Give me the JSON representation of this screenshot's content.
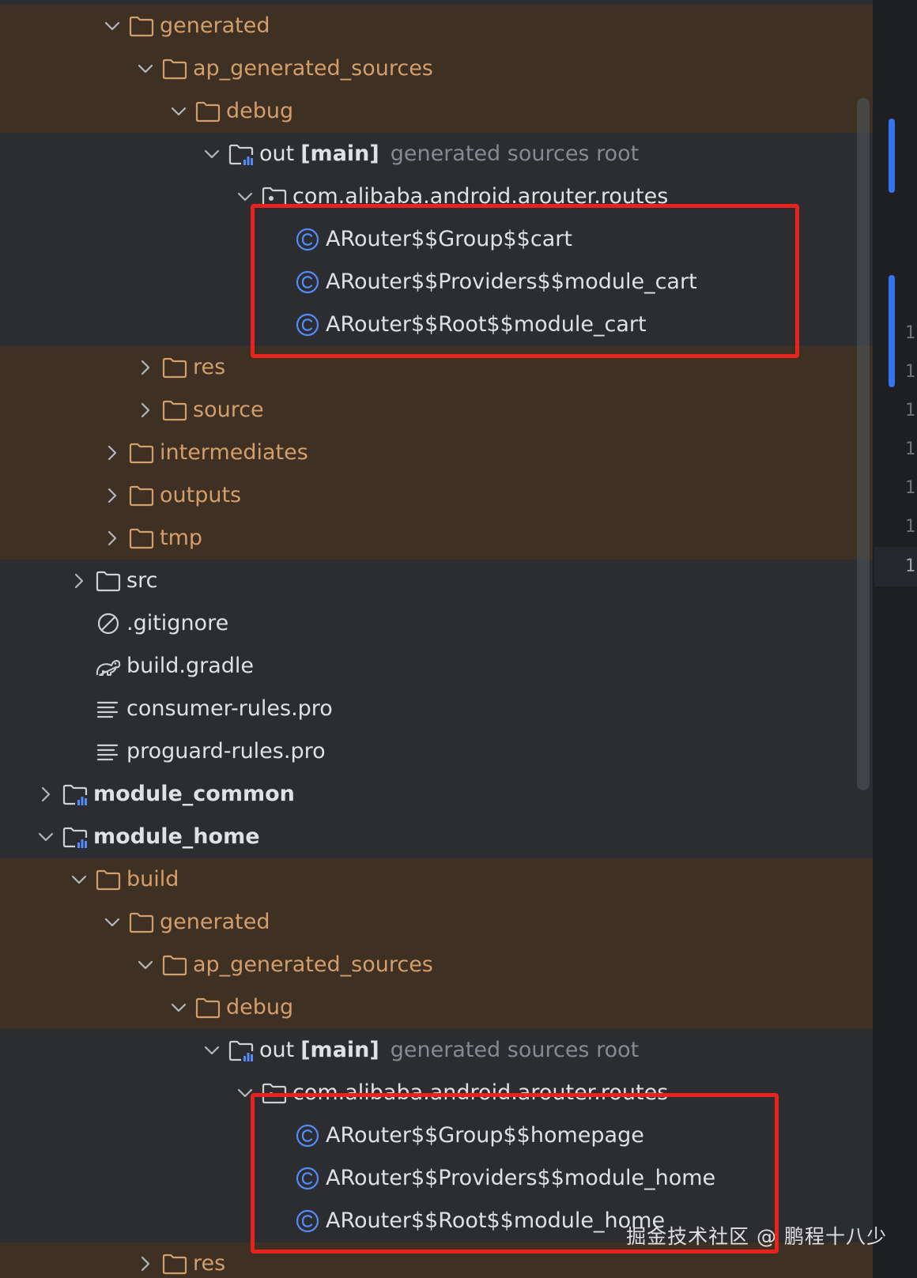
{
  "tree": [
    {
      "label": "generated",
      "icon": "folder-icon",
      "depth": 3,
      "chevron": "down",
      "tone": "excluded"
    },
    {
      "label": "ap_generated_sources",
      "icon": "folder-icon",
      "depth": 4,
      "chevron": "down",
      "tone": "excluded"
    },
    {
      "label": "debug",
      "icon": "folder-icon",
      "depth": 5,
      "chevron": "down",
      "tone": "excluded"
    },
    {
      "label": "out",
      "tag": "[main]",
      "hint": "generated sources root",
      "icon": "generated-root-icon",
      "depth": 6,
      "chevron": "down",
      "tone": "normal"
    },
    {
      "label": "com.alibaba.android.arouter.routes",
      "icon": "package-icon",
      "depth": 7,
      "chevron": "down",
      "tone": "normal"
    },
    {
      "label": "ARouter$$Group$$cart",
      "icon": "class-icon",
      "depth": 8,
      "chevron": "none",
      "tone": "normal"
    },
    {
      "label": "ARouter$$Providers$$module_cart",
      "icon": "class-icon",
      "depth": 8,
      "chevron": "none",
      "tone": "normal"
    },
    {
      "label": "ARouter$$Root$$module_cart",
      "icon": "class-icon",
      "depth": 8,
      "chevron": "none",
      "tone": "normal"
    },
    {
      "label": "res",
      "icon": "folder-icon",
      "depth": 4,
      "chevron": "right",
      "tone": "excluded"
    },
    {
      "label": "source",
      "icon": "folder-icon",
      "depth": 4,
      "chevron": "right",
      "tone": "excluded"
    },
    {
      "label": "intermediates",
      "icon": "folder-icon",
      "depth": 3,
      "chevron": "right",
      "tone": "excluded"
    },
    {
      "label": "outputs",
      "icon": "folder-icon",
      "depth": 3,
      "chevron": "right",
      "tone": "excluded"
    },
    {
      "label": "tmp",
      "icon": "folder-icon",
      "depth": 3,
      "chevron": "right",
      "tone": "excluded"
    },
    {
      "label": "src",
      "icon": "folder-icon",
      "depth": 2,
      "chevron": "right",
      "tone": "normal"
    },
    {
      "label": ".gitignore",
      "icon": "ignore-file-icon",
      "depth": 2,
      "chevron": "none",
      "tone": "normal"
    },
    {
      "label": "build.gradle",
      "icon": "gradle-icon",
      "depth": 2,
      "chevron": "none",
      "tone": "normal"
    },
    {
      "label": "consumer-rules.pro",
      "icon": "text-file-icon",
      "depth": 2,
      "chevron": "none",
      "tone": "normal"
    },
    {
      "label": "proguard-rules.pro",
      "icon": "text-file-icon",
      "depth": 2,
      "chevron": "none",
      "tone": "normal"
    },
    {
      "label": "module_common",
      "icon": "module-icon",
      "depth": 1,
      "chevron": "right",
      "tone": "normal",
      "bold": true
    },
    {
      "label": "module_home",
      "icon": "module-icon",
      "depth": 1,
      "chevron": "down",
      "tone": "normal",
      "bold": true
    },
    {
      "label": "build",
      "icon": "folder-icon",
      "depth": 2,
      "chevron": "down",
      "tone": "excluded"
    },
    {
      "label": "generated",
      "icon": "folder-icon",
      "depth": 3,
      "chevron": "down",
      "tone": "excluded"
    },
    {
      "label": "ap_generated_sources",
      "icon": "folder-icon",
      "depth": 4,
      "chevron": "down",
      "tone": "excluded"
    },
    {
      "label": "debug",
      "icon": "folder-icon",
      "depth": 5,
      "chevron": "down",
      "tone": "excluded"
    },
    {
      "label": "out",
      "tag": "[main]",
      "hint": "generated sources root",
      "icon": "generated-root-icon",
      "depth": 6,
      "chevron": "down",
      "tone": "normal"
    },
    {
      "label": "com.alibaba.android.arouter.routes",
      "icon": "package-icon",
      "depth": 7,
      "chevron": "down",
      "tone": "normal"
    },
    {
      "label": "ARouter$$Group$$homepage",
      "icon": "class-icon",
      "depth": 8,
      "chevron": "none",
      "tone": "normal"
    },
    {
      "label": "ARouter$$Providers$$module_home",
      "icon": "class-icon",
      "depth": 8,
      "chevron": "none",
      "tone": "normal"
    },
    {
      "label": "ARouter$$Root$$module_home",
      "icon": "class-icon",
      "depth": 8,
      "chevron": "none",
      "tone": "normal"
    },
    {
      "label": "res",
      "icon": "folder-icon",
      "depth": 4,
      "chevron": "right",
      "tone": "excluded"
    }
  ],
  "gutter": {
    "line_numbers": [
      "1",
      "1",
      "1",
      "1",
      "1",
      "1",
      "1"
    ]
  },
  "watermark": "掘金技术社区 @ 鹏程十八少",
  "colors": {
    "excluded_bg": "#3e3023",
    "normal_bg": "#2b2d30",
    "excluded_text": "#d49e6a",
    "normal_text": "#dfe1e5",
    "hint_text": "#868a91",
    "accent_blue": "#3574f0",
    "highlight_red": "#e8231d"
  }
}
